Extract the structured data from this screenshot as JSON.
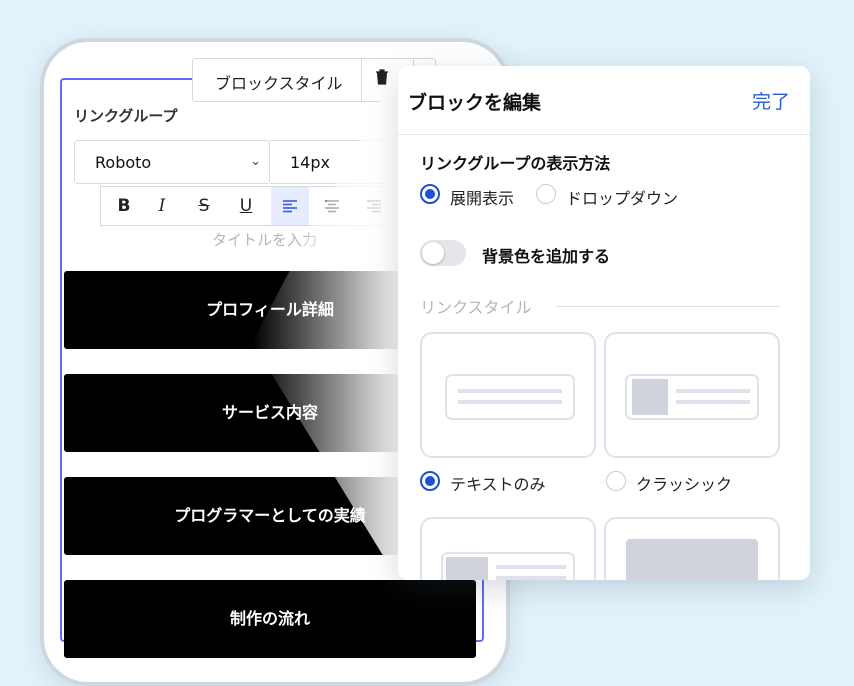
{
  "phone": {
    "toolbar": {
      "label": "ブロックスタイル",
      "delete_icon": "trash-icon"
    },
    "group_label": "リンクグループ",
    "font": {
      "family": "Roboto",
      "size": "14px"
    },
    "format_buttons": [
      "B",
      "I",
      "S",
      "U",
      "align-left",
      "align-center",
      "align-right"
    ],
    "title_placeholder": "タイトルを入力",
    "link_blocks": [
      "プロフィール詳細",
      "サービス内容",
      "プログラマーとしての実績",
      "制作の流れ"
    ]
  },
  "panel": {
    "title": "ブロックを編集",
    "done": "完了",
    "display_method": {
      "title": "リンクグループの表示方法",
      "options": [
        "展開表示",
        "ドロップダウン"
      ],
      "selected": "展開表示"
    },
    "background": {
      "label": "背景色を追加する",
      "enabled": false
    },
    "link_style": {
      "title": "リンクスタイル",
      "options": [
        "テキストのみ",
        "クラッシック"
      ],
      "selected": "テキストのみ"
    }
  },
  "colors": {
    "accent": "#1d4fd8",
    "selection": "#5b6cf5",
    "block": "#000000"
  }
}
